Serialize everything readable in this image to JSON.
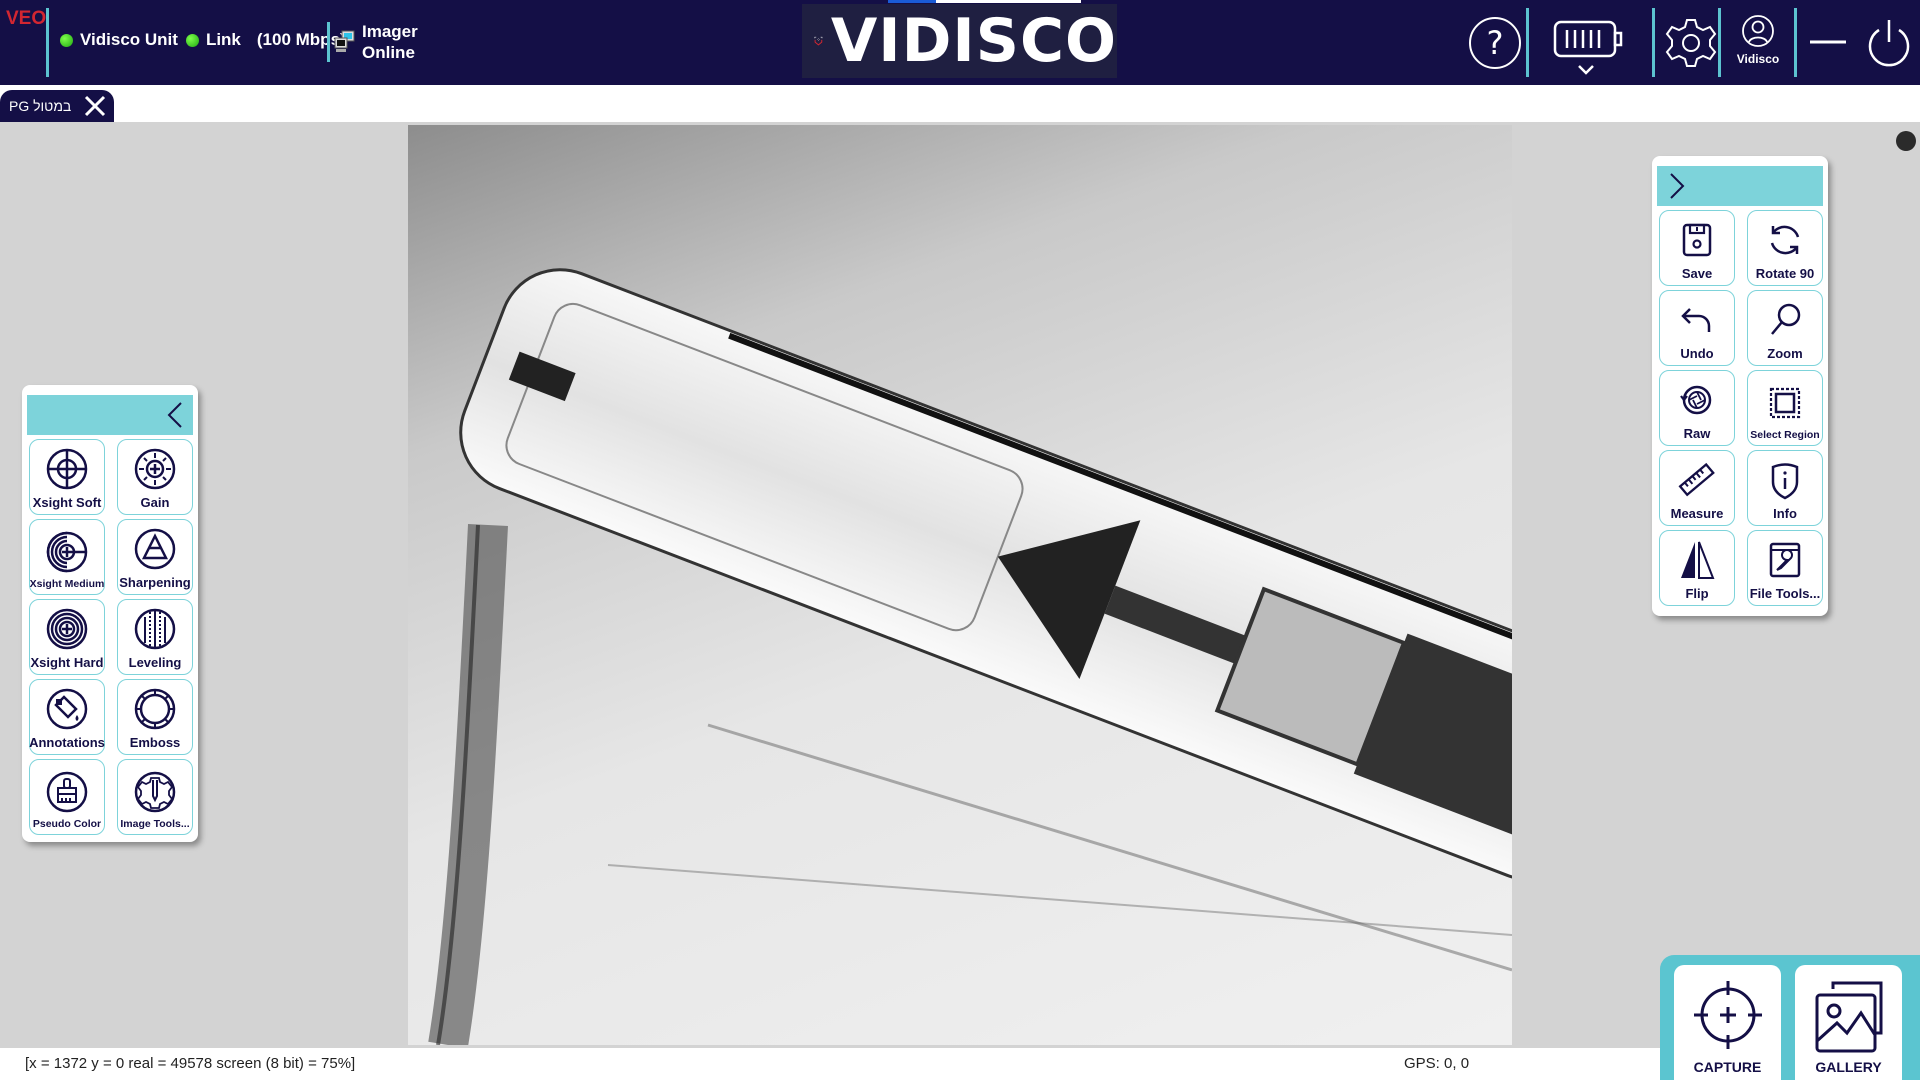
{
  "header": {
    "app_badge": "VEO",
    "unit_label": "Vidisco Unit",
    "link_label": "Link",
    "link_speed": "(100 Mbps)",
    "imager_line1": "Imager",
    "imager_line2": "Online",
    "brand": "VIDISCO",
    "user_label": "Vidisco",
    "status_color": "#2fd11f",
    "brand_red": "#d22631",
    "bar_color": "#140f46",
    "accent": "#5cc3d0"
  },
  "tabs": [
    {
      "label": "PG במטול",
      "active": true
    }
  ],
  "left_panel": {
    "collapse_icon": "chevron-left-icon",
    "tools": [
      {
        "label": "Xsight Soft",
        "icon": "xsight-soft-icon"
      },
      {
        "label": "Gain",
        "icon": "gain-icon"
      },
      {
        "label": "Xsight Medium",
        "icon": "xsight-medium-icon"
      },
      {
        "label": "Sharpening",
        "icon": "sharpening-icon"
      },
      {
        "label": "Xsight Hard",
        "icon": "xsight-hard-icon"
      },
      {
        "label": "Leveling",
        "icon": "leveling-icon"
      },
      {
        "label": "Annotations",
        "icon": "annotations-icon"
      },
      {
        "label": "Emboss",
        "icon": "emboss-icon"
      },
      {
        "label": "Pseudo Color",
        "icon": "pseudo-color-icon"
      },
      {
        "label": "Image Tools...",
        "icon": "image-tools-icon"
      }
    ]
  },
  "right_panel": {
    "collapse_icon": "chevron-right-icon",
    "tools": [
      {
        "label": "Save",
        "icon": "floppy-icon"
      },
      {
        "label": "Rotate 90",
        "icon": "rotate-icon"
      },
      {
        "label": "Undo",
        "icon": "undo-icon"
      },
      {
        "label": "Zoom",
        "icon": "magnifier-icon"
      },
      {
        "label": "Raw",
        "icon": "raw-icon"
      },
      {
        "label": "Select Region",
        "icon": "select-region-icon"
      },
      {
        "label": "Measure",
        "icon": "ruler-icon"
      },
      {
        "label": "Info",
        "icon": "info-shield-icon"
      },
      {
        "label": "Flip",
        "icon": "flip-icon"
      },
      {
        "label": "File Tools...",
        "icon": "file-tools-icon"
      }
    ]
  },
  "status": {
    "pixel_readout": "[x = 1372 y = 0 real = 49578 screen (8 bit) = 75%]",
    "gps": "GPS: 0, 0"
  },
  "actions": {
    "capture_label": "CAPTURE",
    "gallery_label": "GALLERY"
  }
}
